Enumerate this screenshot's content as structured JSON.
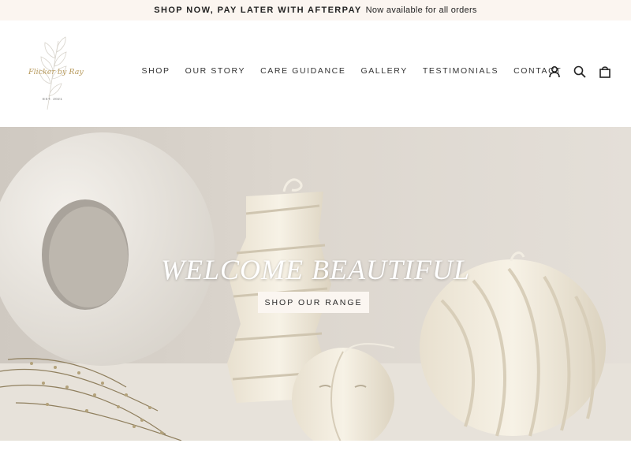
{
  "announcement": {
    "bold_text": "SHOP NOW, PAY LATER WITH AFTERPAY",
    "light_text": "Now available for all orders"
  },
  "logo": {
    "script_text": "Flicker by Ray",
    "est_text": "EST. 2021",
    "icon": "leaf-branch-icon"
  },
  "nav": {
    "items": [
      {
        "label": "SHOP"
      },
      {
        "label": "OUR STORY"
      },
      {
        "label": "CARE GUIDANCE"
      },
      {
        "label": "GALLERY"
      },
      {
        "label": "TESTIMONIALS"
      },
      {
        "label": "CONTACT"
      }
    ]
  },
  "header_icons": [
    "user-icon",
    "search-icon",
    "cart-icon"
  ],
  "hero": {
    "title": "WELCOME BEAUTIFUL",
    "button_label": "SHOP OUR RANGE"
  },
  "colors": {
    "announcement_bg": "#fbf5f0",
    "logo_gold": "#b89b5e",
    "hero_button_bg": "#fbf6f1"
  }
}
